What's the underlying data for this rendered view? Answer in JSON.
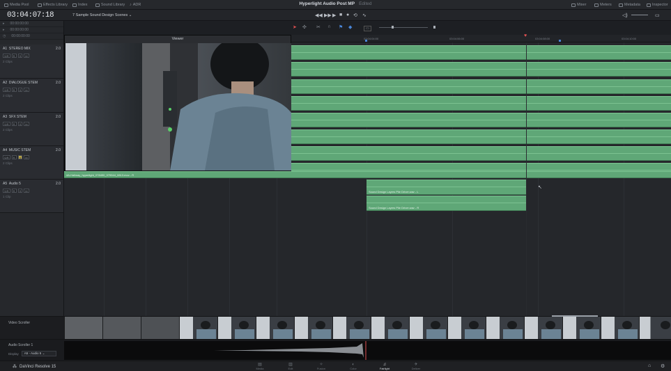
{
  "topbar": {
    "left_items": [
      "Media Pool",
      "Effects Library",
      "Index",
      "Sound Library",
      "ADR"
    ],
    "project_name": "Hyperlight Audio Post MP",
    "project_state": "Edited",
    "right_items": [
      "Mixer",
      "Meters",
      "Metadata",
      "Inspector"
    ]
  },
  "timecode": "03:04:07:18",
  "timeline_name": "7 Sample Sound Design Scenes",
  "tc_rows": [
    "00:00:00:00",
    "00:00:00:00",
    "00:00:00:00"
  ],
  "tracks": [
    {
      "id": "A1",
      "name": "STEREO MIX",
      "fmt": "2.0",
      "clips": "2 Clips"
    },
    {
      "id": "A2",
      "name": "DIALOGUE STEM",
      "fmt": "2.0",
      "clips": "2 Clips"
    },
    {
      "id": "A3",
      "name": "SFX STEM",
      "fmt": "2.0",
      "clips": "2 Clips"
    },
    {
      "id": "A4",
      "name": "MUSIC STEM",
      "fmt": "2.0",
      "clips": "2 Clips"
    },
    {
      "id": "A5",
      "name": "Audio 5",
      "fmt": "2.0",
      "clips": "1 Clip"
    }
  ],
  "track_buttons": [
    "S/R",
    "R",
    "S",
    "M"
  ],
  "ruler_ticks": [
    "03:04:04:00",
    "03:04:06:00",
    "03:04:08:00",
    "03:04:10:00"
  ],
  "viewer_title": "Viewer",
  "clip_labels": {
    "a4_clip": "4A-Hallway_hyperlight_078490_079544_0813.mov - R",
    "a5_clip_l": "Sound Design Layers Pile Driver.wav - L",
    "a5_clip_r": "Sound Design Layers Pile Driver.wav - R"
  },
  "video_scroller_label": "Video Scroller",
  "audio_scroller_label": "Audio Scroller 1",
  "display_label": "Display",
  "display_value": "A5 - Audio 5",
  "brand": "DaVinci Resolve 15",
  "pages": [
    "Media",
    "Edit",
    "Fusion",
    "Color",
    "Fairlight",
    "Deliver"
  ],
  "active_page": "Fairlight",
  "colors": {
    "clip_green": "#5fa777",
    "playhead": "#e25252",
    "background": "#1d1f23"
  }
}
